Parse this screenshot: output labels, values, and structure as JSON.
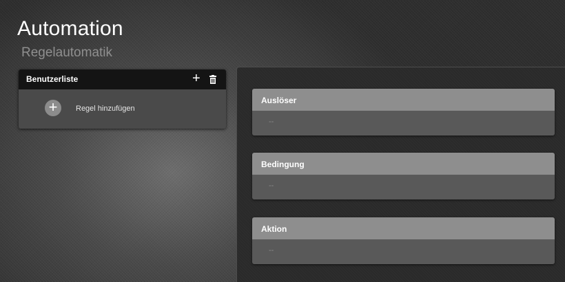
{
  "header": {
    "title": "Automation",
    "subtitle": "Regelautomatik"
  },
  "list_panel": {
    "title": "Benutzerliste",
    "add_icon": "plus-icon",
    "delete_icon": "trash-icon",
    "add_rule_label": "Regel hinzufügen"
  },
  "detail": {
    "sections": [
      {
        "title": "Auslöser",
        "value": "--"
      },
      {
        "title": "Bedingung",
        "value": "--"
      },
      {
        "title": "Aktion",
        "value": "--"
      }
    ]
  },
  "colors": {
    "list_header_bg": "#141414",
    "section_header_bg": "#8e8e8e",
    "section_body_bg": "#595959",
    "subtitle_text": "#8f8f8f"
  }
}
